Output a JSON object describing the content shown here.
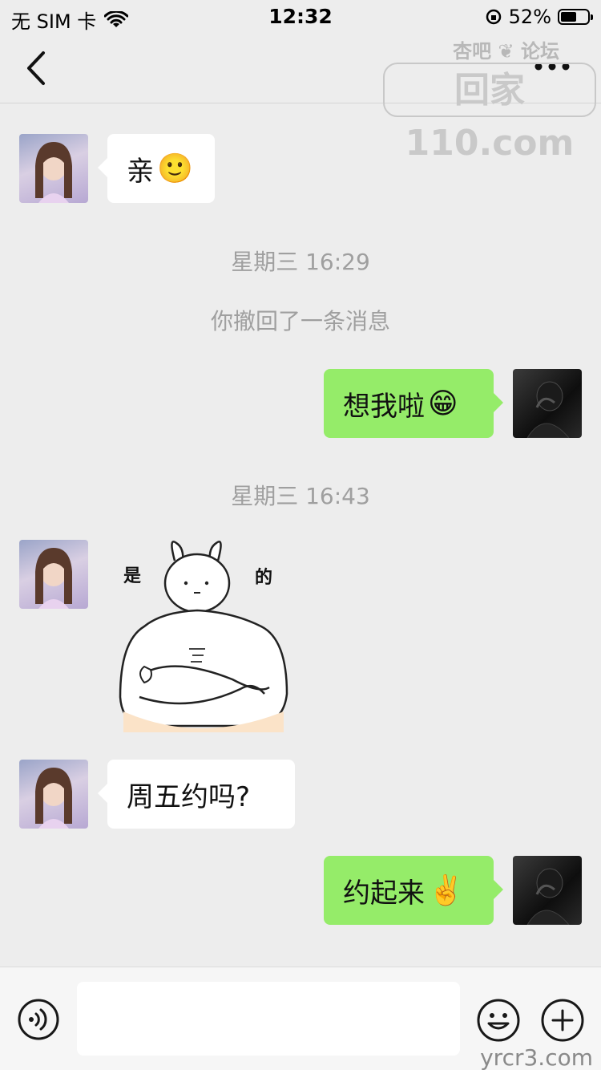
{
  "status_bar": {
    "carrier": "无 SIM 卡",
    "time": "12:32",
    "battery_percent": "52%"
  },
  "nav": {
    "title": "",
    "back_icon": "chevron-left-icon",
    "more_icon": "more-dots-icon"
  },
  "watermark": {
    "top_small": "杏吧 ❦ 论坛",
    "top_big": "回家110.com",
    "bottom": "yrcr3.com"
  },
  "messages": [
    {
      "side": "in",
      "text": "亲",
      "emoji": "🙂"
    },
    {
      "side": "time",
      "text": "星期三 16:29"
    },
    {
      "side": "system",
      "text": "你撤回了一条消息"
    },
    {
      "side": "out",
      "text": "想我啦",
      "emoji": "😁"
    },
    {
      "side": "time",
      "text": "星期三 16:43"
    },
    {
      "side": "in",
      "sticker_text_left": "是",
      "sticker_text_right": "的"
    },
    {
      "side": "in",
      "text": "周五约吗?"
    },
    {
      "side": "out",
      "text": "约起来",
      "emoji": "✌️"
    }
  ],
  "input_bar": {
    "placeholder": "",
    "voice_icon": "voice-icon",
    "emoji_icon": "emoji-icon",
    "plus_icon": "plus-icon"
  },
  "colors": {
    "background": "#ededed",
    "incoming_bubble": "#ffffff",
    "outgoing_bubble": "#95ec69",
    "meta_text": "#9f9f9f"
  }
}
